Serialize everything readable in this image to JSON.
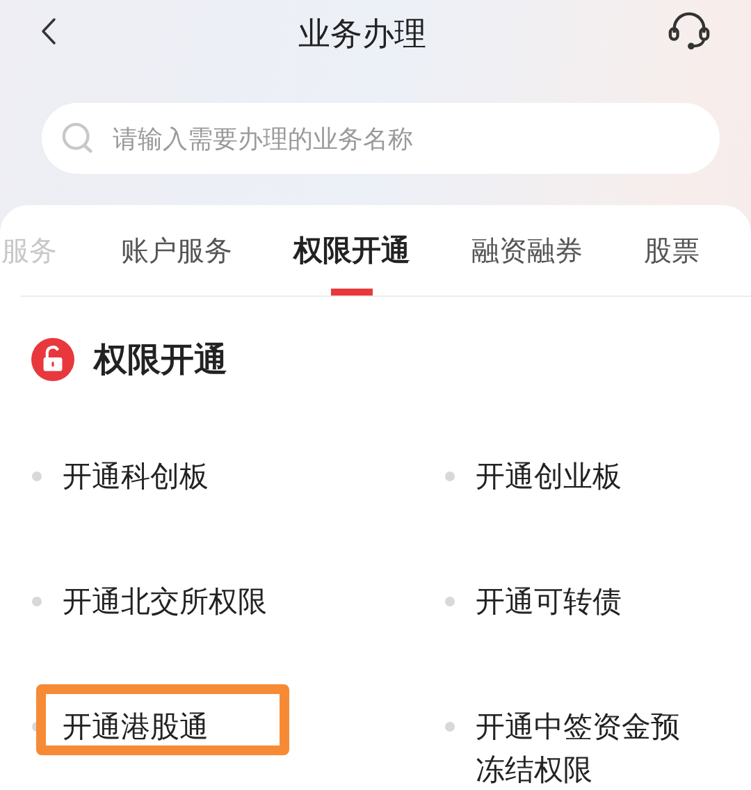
{
  "header": {
    "title": "业务办理"
  },
  "search": {
    "placeholder": "请输入需要办理的业务名称"
  },
  "tabs": [
    {
      "label": "服务",
      "selected": false,
      "faded": true
    },
    {
      "label": "账户服务",
      "selected": false,
      "faded": false
    },
    {
      "label": "权限开通",
      "selected": true,
      "faded": false
    },
    {
      "label": "融资融券",
      "selected": false,
      "faded": false
    },
    {
      "label": "股票",
      "selected": false,
      "faded": false
    }
  ],
  "section": {
    "title": "权限开通"
  },
  "items": [
    {
      "label": "开通科创板",
      "highlighted": false
    },
    {
      "label": "开通创业板",
      "highlighted": false
    },
    {
      "label": "开通北交所权限",
      "highlighted": false
    },
    {
      "label": "开通可转债",
      "highlighted": false
    },
    {
      "label": "开通港股通",
      "highlighted": true
    },
    {
      "label": "开通中签资金预冻结权限",
      "highlighted": false
    }
  ]
}
